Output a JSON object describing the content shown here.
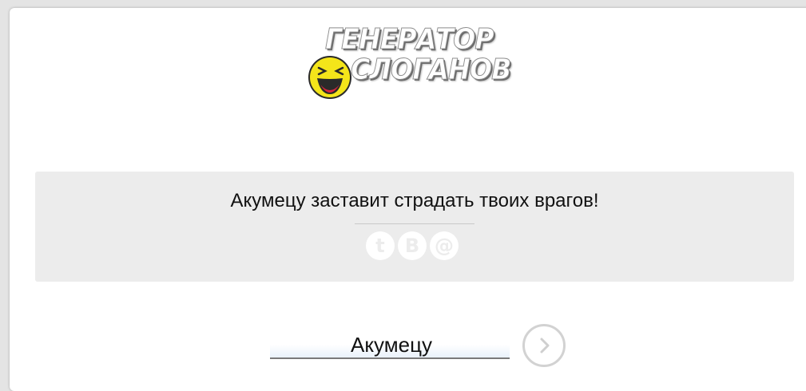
{
  "logo": {
    "line1": "ГЕНЕРАТОР",
    "line2": "СЛОГАНОВ"
  },
  "slogan": {
    "text": "Акумецу заставит страдать твоих врагов!"
  },
  "share": {
    "icons": [
      "twitter-icon",
      "vkontakte-icon",
      "email-icon"
    ],
    "twitter_glyph": "t",
    "vk_glyph": "B",
    "email_glyph": "@"
  },
  "name_input": {
    "value": "Акумецу"
  },
  "colors": {
    "background": "#e4e4e4",
    "panel": "#ffffff",
    "slogan_box": "#ececec",
    "smiley": "#f4e51a"
  }
}
